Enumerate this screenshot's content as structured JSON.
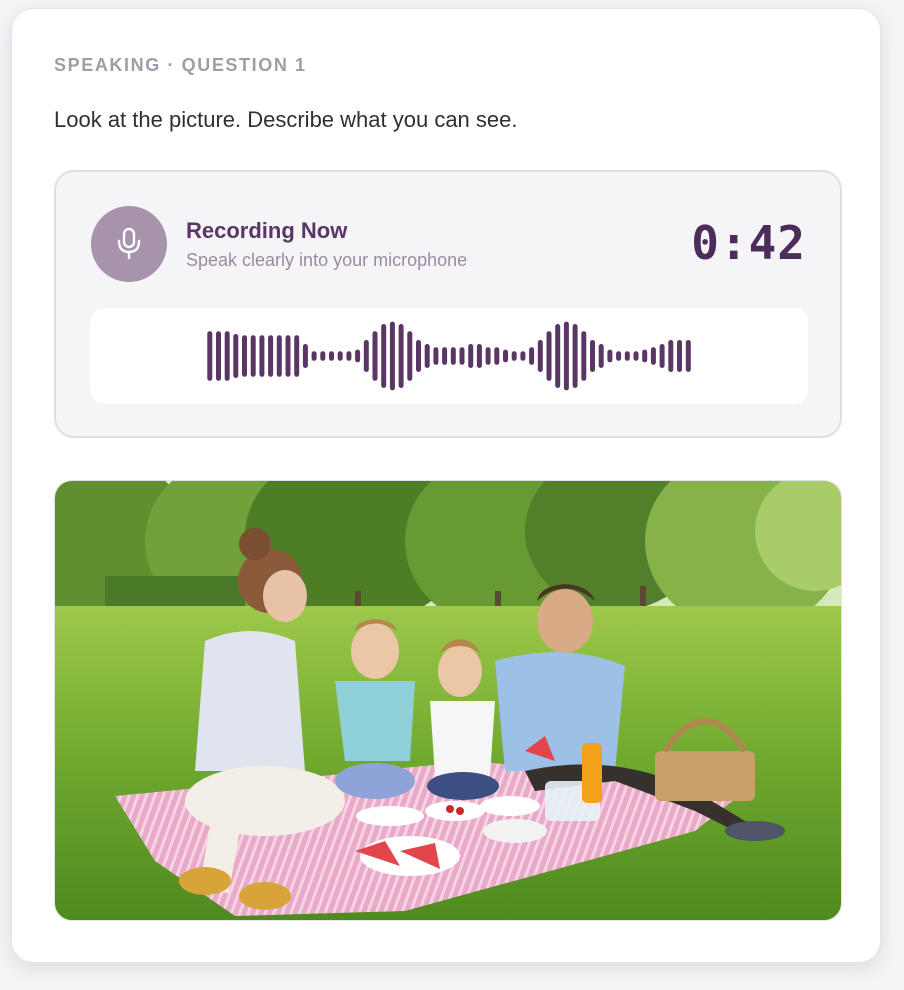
{
  "question": {
    "eyebrow": "SPEAKING · QUESTION 1",
    "prompt": "Look at the picture. Describe what you can see."
  },
  "recorder": {
    "title": "Recording Now",
    "subtitle": "Speak clearly into your microphone",
    "timer": "0:42",
    "mic_icon": "microphone-icon",
    "accent_color": "#5a3665",
    "mic_bg_color": "#a793ac",
    "waveform_levels": [
      0.62,
      0.62,
      0.62,
      0.55,
      0.52,
      0.52,
      0.52,
      0.52,
      0.52,
      0.52,
      0.52,
      0.3,
      0.12,
      0.12,
      0.12,
      0.12,
      0.12,
      0.16,
      0.4,
      0.62,
      0.8,
      0.86,
      0.8,
      0.62,
      0.4,
      0.3,
      0.22,
      0.22,
      0.22,
      0.22,
      0.3,
      0.3,
      0.22,
      0.22,
      0.16,
      0.12,
      0.12,
      0.22,
      0.4,
      0.62,
      0.8,
      0.86,
      0.8,
      0.62,
      0.4,
      0.3,
      0.16,
      0.12,
      0.12,
      0.12,
      0.16,
      0.22,
      0.3,
      0.4,
      0.4,
      0.4
    ]
  },
  "photo": {
    "subject": "Family picnic on a pink blanket in a sunny park"
  }
}
